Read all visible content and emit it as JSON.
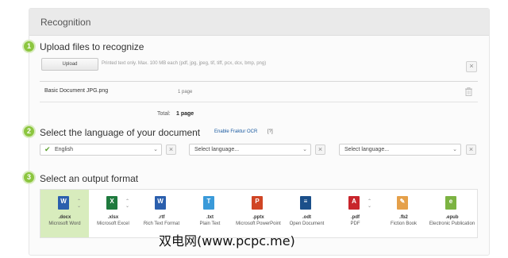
{
  "panel": {
    "title": "Recognition"
  },
  "step1": {
    "number": "1",
    "title": "Upload files to recognize",
    "upload_label": "Upload",
    "hint": "Printed text only. Max. 100 MB each (pdf, jpg, jpeg, tif, tiff, pcx, dcx, bmp, png)",
    "close": "×"
  },
  "file": {
    "name": "Basic Document JPG.png",
    "pages": "1 page"
  },
  "total": {
    "label": "Total:",
    "value": "1 page"
  },
  "step2": {
    "number": "2",
    "title": "Select the language of your document",
    "fraktur_link": "Enable Fraktur OCR",
    "fraktur_help": "[?]",
    "languages": [
      {
        "value": "English"
      },
      {
        "placeholder": "Select language..."
      },
      {
        "placeholder": "Select language..."
      }
    ],
    "clear": "×"
  },
  "step3": {
    "number": "3",
    "title": "Select an output format",
    "formats": [
      {
        "ext": ".docx",
        "name": "Microsoft Word",
        "icon": "word-icon",
        "letter": "W",
        "color": "#2b5fad",
        "selected": true
      },
      {
        "ext": ".xlsx",
        "name": "Microsoft Excel",
        "icon": "excel-icon",
        "letter": "X",
        "color": "#1f7a3e"
      },
      {
        "ext": ".rtf",
        "name": "Rich Text Format",
        "icon": "word-icon",
        "letter": "W",
        "color": "#2b5fad"
      },
      {
        "ext": ".txt",
        "name": "Plain Text",
        "icon": "text-icon",
        "letter": "T",
        "color": "#3a9ad9"
      },
      {
        "ext": ".pptx",
        "name": "Microsoft PowerPoint",
        "icon": "powerpoint-icon",
        "letter": "P",
        "color": "#d04525"
      },
      {
        "ext": ".odt",
        "name": "Open Document",
        "icon": "odt-icon",
        "letter": "≡",
        "color": "#1b4f8a"
      },
      {
        "ext": ".pdf",
        "name": "PDF",
        "icon": "pdf-icon",
        "letter": "A",
        "color": "#c8252c"
      },
      {
        "ext": ".fb2",
        "name": "Fiction Book",
        "icon": "fb2-icon",
        "letter": "✎",
        "color": "#e5a04a"
      },
      {
        "ext": ".epub",
        "name": "Electronic Publication",
        "icon": "epub-icon",
        "letter": "e",
        "color": "#7cb342"
      }
    ]
  },
  "watermark": "双电网(www.pcpc.me)"
}
